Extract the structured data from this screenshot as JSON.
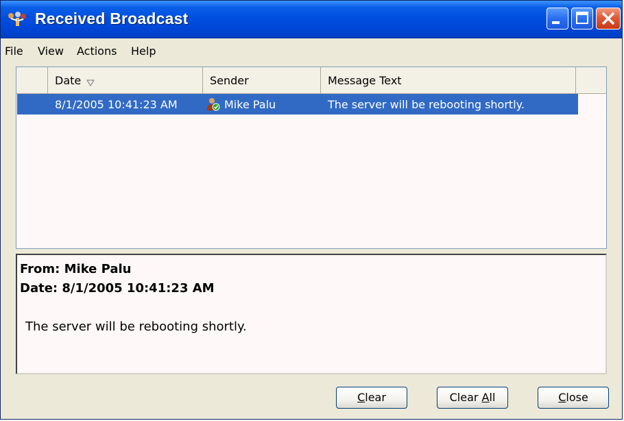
{
  "window": {
    "title": "Received Broadcast",
    "icon": "broadcast-icon",
    "controls": [
      "minimize",
      "maximize",
      "close"
    ]
  },
  "menu": {
    "items": [
      "File",
      "View",
      "Actions",
      "Help"
    ]
  },
  "list": {
    "columns": [
      {
        "label": "Date",
        "sorted": "descending"
      },
      {
        "label": "Sender"
      },
      {
        "label": "Message Text"
      }
    ],
    "rows": [
      {
        "date": "8/1/2005 10:41:23 AM",
        "sender": "Mike Palu",
        "sender_icon": "user-icon",
        "message": "The server will be rebooting shortly.",
        "selected": true
      }
    ]
  },
  "detail": {
    "from_line": "From: Mike Palu",
    "date_line": "Date: 8/1/2005 10:41:23 AM",
    "body": "The server will be rebooting shortly."
  },
  "buttons": {
    "clear": {
      "before": "",
      "accel": "C",
      "after": "lear"
    },
    "clear_all": {
      "before": "Clear ",
      "accel": "A",
      "after": "ll"
    },
    "close": {
      "before": "",
      "accel": "C",
      "after": "lose"
    }
  },
  "colors": {
    "titlebar": "#0050e0",
    "selection": "#316ac5",
    "window_bg": "#ece9d8",
    "panel_bg": "#fff8f8"
  }
}
